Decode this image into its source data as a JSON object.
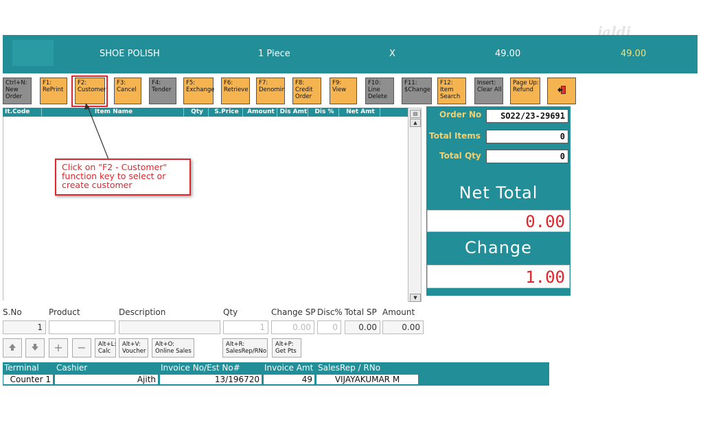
{
  "watermark": "jaldi",
  "banner": {
    "product": "SHOE POLISH",
    "quantity": "1 Piece",
    "multiplier": "X",
    "unit_price": "49.00",
    "line_total": "49.00"
  },
  "function_keys": [
    {
      "key": "Ctrl+N:",
      "label1": "New",
      "label2": "Order",
      "color": "gray"
    },
    {
      "key": "F1:",
      "label1": "RePrint",
      "label2": "",
      "color": "orange"
    },
    {
      "key": "F2:",
      "label1": "Customer",
      "label2": "",
      "color": "orange"
    },
    {
      "key": "F3:",
      "label1": "Cancel",
      "label2": "",
      "color": "orange"
    },
    {
      "key": "F4:",
      "label1": "Tender",
      "label2": "",
      "color": "gray"
    },
    {
      "key": "F5:",
      "label1": "Exchange",
      "label2": "",
      "color": "orange"
    },
    {
      "key": "F6:",
      "label1": "Retrieve",
      "label2": "",
      "color": "orange"
    },
    {
      "key": "F7:",
      "label1": "Denomin",
      "label2": "",
      "color": "orange"
    },
    {
      "key": "F8:",
      "label1": "Credit",
      "label2": "Order",
      "color": "orange"
    },
    {
      "key": "F9:",
      "label1": "View",
      "label2": "",
      "color": "orange"
    },
    {
      "key": "F10:",
      "label1": "Line",
      "label2": "Delete",
      "color": "gray"
    },
    {
      "key": "F11:",
      "label1": "$Change",
      "label2": "",
      "color": "gray"
    },
    {
      "key": "F12:",
      "label1": "Item",
      "label2": "Search",
      "color": "orange"
    },
    {
      "key": "Insert:",
      "label1": "Clear All",
      "label2": "",
      "color": "gray"
    },
    {
      "key": "Page Up:",
      "label1": "Refund",
      "label2": "",
      "color": "orange"
    }
  ],
  "grid": {
    "columns": [
      "It.Code",
      "Item Name",
      "Qty",
      "S.Price",
      "Amount",
      "Dis Amt",
      "Dis %",
      "Net Amt"
    ]
  },
  "callout": {
    "line1": "Click on \"F2 - Customer\"",
    "line2": "function key to select or",
    "line3": "create customer"
  },
  "summary": {
    "order_no_label": "Order No",
    "order_no": "SO22/23-29691",
    "total_items_label": "Total Items",
    "total_items": "0",
    "total_qty_label": "Total Qty",
    "total_qty": "0",
    "net_total_label": "Net Total",
    "net_total": "0.00",
    "change_label": "Change",
    "change": "1.00"
  },
  "entry": {
    "labels": {
      "sno": "S.No",
      "product": "Product",
      "description": "Description",
      "qty": "Qty",
      "change_sp": "Change SP",
      "disc": "Disc%",
      "total_sp": "Total SP",
      "amount": "Amount"
    },
    "values": {
      "sno": "1",
      "product": "",
      "description": "",
      "qty": "1",
      "change_sp": "0.00",
      "disc": "0",
      "total_sp": "0.00",
      "amount": "0.00"
    }
  },
  "shortcut_buttons": [
    {
      "line1": "Alt+L:",
      "line2": "Calc"
    },
    {
      "line1": "Alt+V:",
      "line2": "Voucher"
    },
    {
      "line1": "Alt+O:",
      "line2": "Online Sales"
    },
    {
      "line1": "Alt+R:",
      "line2": "SalesRep/RNo"
    },
    {
      "line1": "Alt+P:",
      "line2": "Get Pts"
    }
  ],
  "footer": {
    "labels": {
      "terminal": "Terminal",
      "cashier": "Cashier",
      "invoice_no": "Invoice No/Est No#",
      "invoice_amt": "Invoice Amt",
      "salesrep": "SalesRep / RNo"
    },
    "values": {
      "terminal": "Counter 1",
      "cashier": "Ajith",
      "invoice_no": "13/196720",
      "invoice_amt": "49",
      "salesrep": "VIJAYAKUMAR M"
    }
  },
  "colors": {
    "teal": "#218e98",
    "orange_key": "#f6b451",
    "gray_key": "#8e8e8e",
    "accent_red": "#e0262b",
    "accent_yellow": "#f4e07a"
  }
}
